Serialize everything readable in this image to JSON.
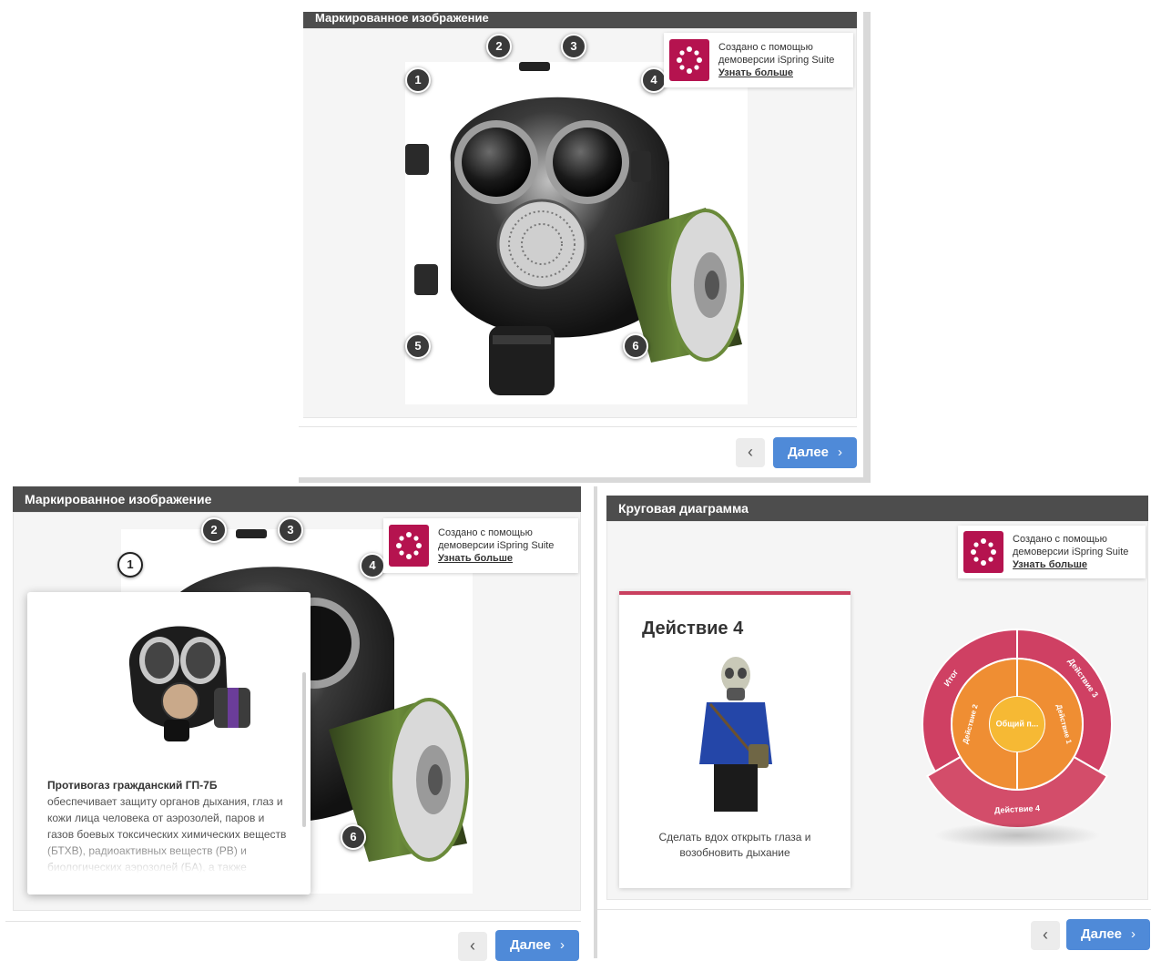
{
  "panel_top": {
    "title": "Маркированное изображение",
    "markers": [
      "1",
      "2",
      "3",
      "4",
      "5",
      "6"
    ],
    "badge": {
      "line1": "Создано с помощью",
      "line2": "демоверсии iSpring Suite",
      "link": "Узнать больше"
    },
    "prev_label": "‹",
    "next_label": "Далее",
    "next_icon": "›"
  },
  "panel_bl": {
    "title": "Маркированное изображение",
    "markers": [
      "1",
      "2",
      "3",
      "4",
      "6"
    ],
    "badge": {
      "line1": "Создано с помощью",
      "line2": "демоверсии iSpring Suite",
      "link": "Узнать больше"
    },
    "popup": {
      "title": "Противогаз гражданский ГП-7Б",
      "body": "обеспечивает защиту органов дыхания, глаз и кожи лица человека от аэрозолей, паров и газов боевых токсических химических веществ (БТХВ), радиоактивных веществ (РВ) и биологических аэрозолей (БА), а также"
    },
    "prev_label": "‹",
    "next_label": "Далее",
    "next_icon": "›"
  },
  "panel_br": {
    "title": "Круговая диаграмма",
    "badge": {
      "line1": "Создано с помощью",
      "line2": "демоверсии iSpring Suite",
      "link": "Узнать больше"
    },
    "card": {
      "heading": "Действие 4",
      "caption_line1": "Сделать вдох открыть глаза и",
      "caption_line2": "возобновить дыхание"
    },
    "prev_label": "‹",
    "next_label": "Далее",
    "next_icon": "›"
  },
  "radial_chart": {
    "type": "radial-menu",
    "center_label": "Общий п...",
    "inner_labels": [
      "Действие 2",
      "Действие 1"
    ],
    "outer_labels": [
      "Итог",
      "Действие 3",
      "Действие 4"
    ],
    "colors": {
      "center": "#f6b934",
      "inner": "#ef8e33",
      "outer": "#cf4063",
      "outer_active": "#d34d6a"
    }
  }
}
